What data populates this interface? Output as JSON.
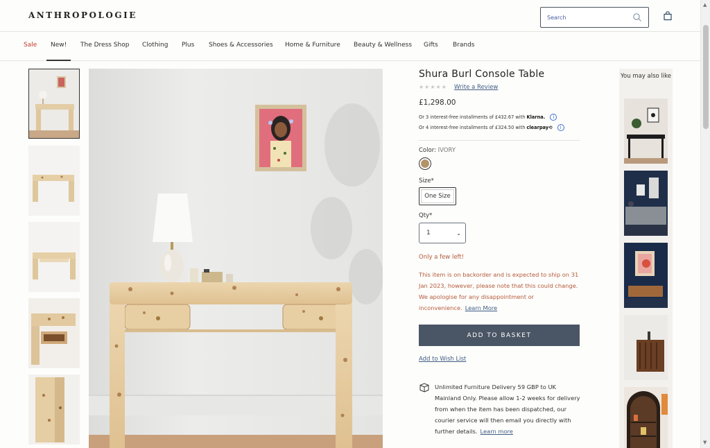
{
  "header": {
    "logo": "ANTHROPOLOGIE",
    "search_placeholder": "Search"
  },
  "nav": {
    "items": [
      "Sale",
      "New!",
      "The Dress Shop",
      "Clothing",
      "Plus",
      "Shoes & Accessories",
      "Home & Furniture",
      "Beauty & Wellness",
      "Gifts",
      "Brands"
    ],
    "active": "New!"
  },
  "product": {
    "title": "Shura Burl Console Table",
    "stars": "★★★★★",
    "write_review": "Write a Review",
    "price": "£1,298.00",
    "klarna_text": "Or 3 interest-free installments of £432.67 with",
    "klarna_brand": "Klarna.",
    "clearpay_text": "Or 4 interest-free installments of £324.50 with",
    "clearpay_brand": "clearpay⟲",
    "color_label": "Color:",
    "color_value": "IVORY",
    "color_swatch": "#b39468",
    "size_label": "Size*",
    "size_option": "One Size",
    "qty_label": "Qty*",
    "qty_value": "1",
    "stock_warning": "Only a few left!",
    "backorder_text": "This item is on backorder and is expected to ship on 31 Jan 2023, however, please note that this could change. We apologise for any disappointment or inconvenience.",
    "backorder_link": "Learn More",
    "add_to_basket": "ADD TO BASKET",
    "wishlist": "Add to Wish List",
    "delivery_text": "Unlimited Furniture Delivery 59 GBP to UK Mainland Only. Please allow 1-2 weeks for delivery from when the item has been dispatched, our courier service will then email you directly with further details.",
    "delivery_link": "Learn more"
  },
  "recommendations": {
    "heading": "You may also like"
  },
  "colors": {
    "accent": "#4a5565",
    "link": "#3f5c84",
    "warning": "#b4593a",
    "sale": "#c0392b"
  }
}
